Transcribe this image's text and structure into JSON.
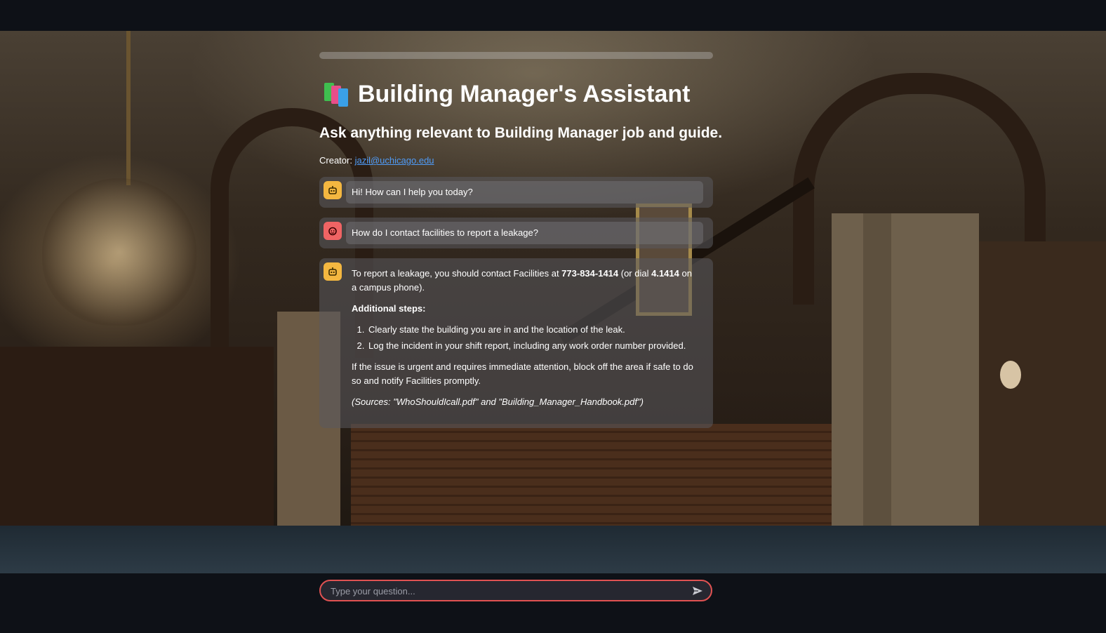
{
  "header": {
    "title": "Building Manager's Assistant",
    "title_icon": "books-icon",
    "subtitle": "Ask anything relevant to Building Manager job and guide.",
    "creator_label": "Creator:",
    "creator_email": "jazil@uchicago.edu"
  },
  "messages": [
    {
      "role": "assistant",
      "avatar_icon": "bot-icon",
      "text": "Hi! How can I help you today?"
    },
    {
      "role": "user",
      "avatar_icon": "user-icon",
      "text": "How do I contact facilities to report a leakage?"
    },
    {
      "role": "assistant",
      "avatar_icon": "bot-icon",
      "intro_1": "To report a leakage, you should contact Facilities at ",
      "phone": "773-834-1414",
      "intro_2": " (or dial ",
      "short_dial": "4.1414",
      "intro_3": " on a campus phone).",
      "steps_heading": "Additional steps:",
      "steps": [
        "Clearly state the building you are in and the location of the leak.",
        "Log the incident in your shift report, including any work order number provided."
      ],
      "closing": "If the issue is urgent and requires immediate attention, block off the area if safe to do so and notify Facilities promptly.",
      "sources": "(Sources: \"WhoShouldIcall.pdf\" and \"Building_Manager_Handbook.pdf\")"
    }
  ],
  "chat_input": {
    "placeholder": "Type your question...",
    "send_icon": "send-icon"
  },
  "colors": {
    "app_background": "#0e1117",
    "bot_avatar": "#f4b740",
    "user_avatar": "#f06464",
    "input_border": "#e05252",
    "link": "#4f9cf9"
  }
}
